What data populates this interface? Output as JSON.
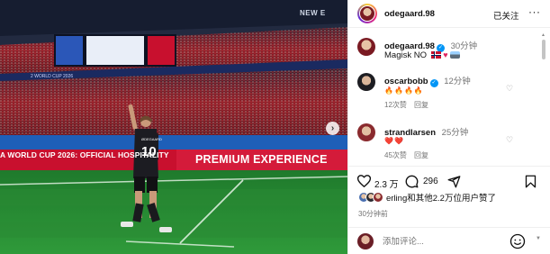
{
  "photo": {
    "ad_banner_left": "A WORLD CUP 2026: OFFICIAL HOSPITALITY",
    "ad_banner_right": "PREMIUM EXPERIENCE",
    "jersey_name": "ØDEGAARD",
    "jersey_number": "10",
    "roof_text": "NEW E",
    "ribbon_text": "2 WORLD CUP 2026",
    "next_icon": "chevron-right-icon"
  },
  "post": {
    "author": "odegaard.98",
    "follow_label": "已关注",
    "more_label": "···",
    "caption_author": "odegaard.98",
    "caption_time": "30分钟",
    "caption_text": "Magisk NO"
  },
  "comments": [
    {
      "username": "oscarbobb",
      "time": "12分钟",
      "likes": "12次赞",
      "reply": "回复",
      "emoji": [
        "🔥",
        "🔥",
        "🔥",
        "🔥"
      ]
    },
    {
      "username": "strandlarsen",
      "time": "25分钟",
      "likes": "45次赞",
      "reply": "回复",
      "emoji": [
        "❤️",
        "❤️"
      ]
    }
  ],
  "actions": {
    "like_count": "2.3 万",
    "comment_count": "296",
    "likes_line": "erling和其他2.2万位用户赞了",
    "time_ago": "30分钟前"
  },
  "composer": {
    "placeholder": "添加评论..."
  },
  "colors": {
    "accent_blue": "#0095f6",
    "norway_red": "#c8102e"
  }
}
